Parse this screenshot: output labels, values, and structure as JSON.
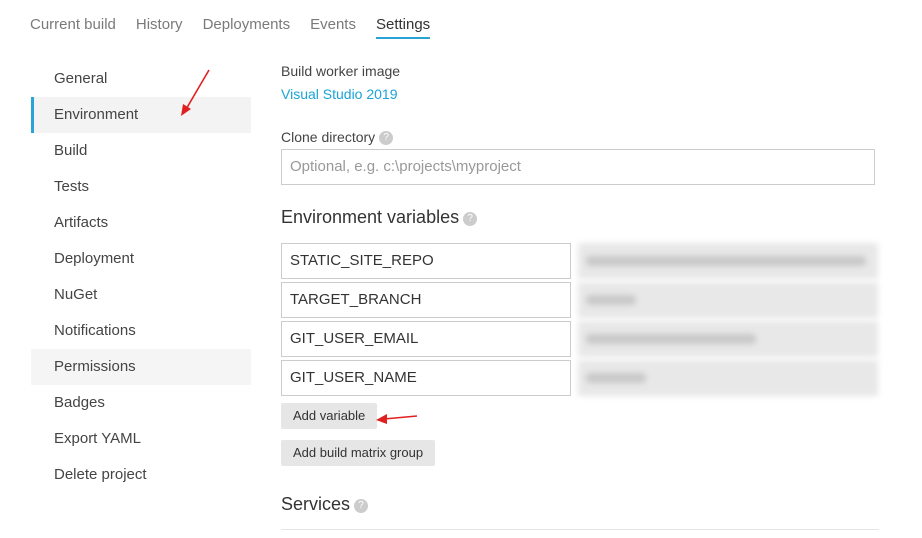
{
  "topnav": {
    "tabs": [
      "Current build",
      "History",
      "Deployments",
      "Events",
      "Settings"
    ]
  },
  "sidebar": {
    "items": [
      "General",
      "Environment",
      "Build",
      "Tests",
      "Artifacts",
      "Deployment",
      "NuGet",
      "Notifications",
      "Permissions",
      "Badges",
      "Export YAML",
      "Delete project"
    ]
  },
  "build_worker": {
    "label": "Build worker image",
    "value": "Visual Studio 2019"
  },
  "clone_directory": {
    "label": "Clone directory",
    "placeholder": "Optional, e.g. c:\\projects\\myproject"
  },
  "env_vars": {
    "title": "Environment variables",
    "names": [
      "STATIC_SITE_REPO",
      "TARGET_BRANCH",
      "GIT_USER_EMAIL",
      "GIT_USER_NAME"
    ],
    "add_variable": "Add variable",
    "add_matrix": "Add build matrix group"
  },
  "services": {
    "title": "Services"
  },
  "colors": {
    "accent": "#2aa3d6",
    "link": "#1aa4d8",
    "arrow": "#e02020"
  },
  "icons": [
    "help-icon",
    "annotation-arrow"
  ]
}
